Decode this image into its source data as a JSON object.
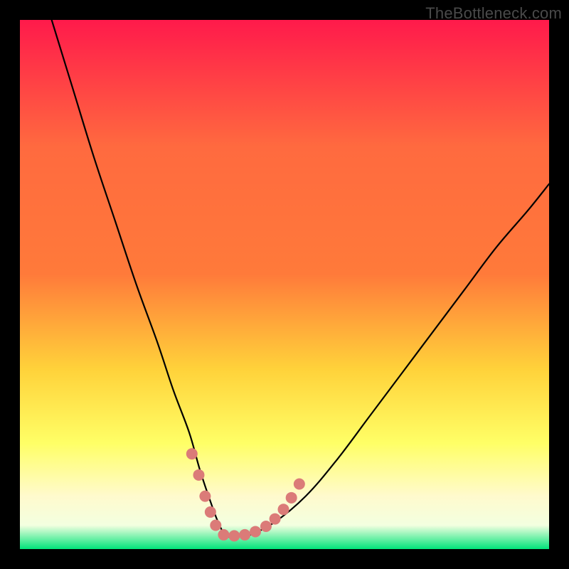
{
  "watermark": "TheBottleneck.com",
  "chart_data": {
    "type": "line",
    "title": "",
    "xlabel": "",
    "ylabel": "",
    "xlim": [
      0,
      100
    ],
    "ylim": [
      0,
      100
    ],
    "background_gradient": {
      "top": "#ff1a4b",
      "upper_mid": "#ff7a3a",
      "mid": "#ffd23a",
      "lower_mid": "#ffff66",
      "near_bottom": "#fffacd",
      "bottom": "#00e47a"
    },
    "series": [
      {
        "name": "bottleneck-curve",
        "color": "#000000",
        "stroke_width": 2.2,
        "x": [
          6,
          10,
          14,
          18,
          22,
          26,
          29,
          32,
          34,
          36,
          37.5,
          39,
          41,
          43,
          48,
          54,
          60,
          66,
          72,
          78,
          84,
          90,
          96,
          100
        ],
        "values": [
          100,
          87,
          74,
          62,
          50,
          39,
          30,
          22,
          15,
          9,
          5,
          2.5,
          2.5,
          2.5,
          5,
          10,
          17,
          25,
          33,
          41,
          49,
          57,
          64,
          69
        ]
      }
    ],
    "markers": {
      "name": "highlight-points",
      "color": "#db7b78",
      "radius": 8,
      "points": [
        {
          "x": 32.5,
          "y": 18
        },
        {
          "x": 33.8,
          "y": 14
        },
        {
          "x": 35.0,
          "y": 10
        },
        {
          "x": 36.0,
          "y": 7
        },
        {
          "x": 37.0,
          "y": 4.5
        },
        {
          "x": 38.5,
          "y": 2.7
        },
        {
          "x": 40.5,
          "y": 2.5
        },
        {
          "x": 42.5,
          "y": 2.7
        },
        {
          "x": 44.5,
          "y": 3.3
        },
        {
          "x": 46.5,
          "y": 4.3
        },
        {
          "x": 48.2,
          "y": 5.7
        },
        {
          "x": 49.8,
          "y": 7.5
        },
        {
          "x": 51.3,
          "y": 9.7
        },
        {
          "x": 52.8,
          "y": 12.3
        }
      ]
    }
  }
}
